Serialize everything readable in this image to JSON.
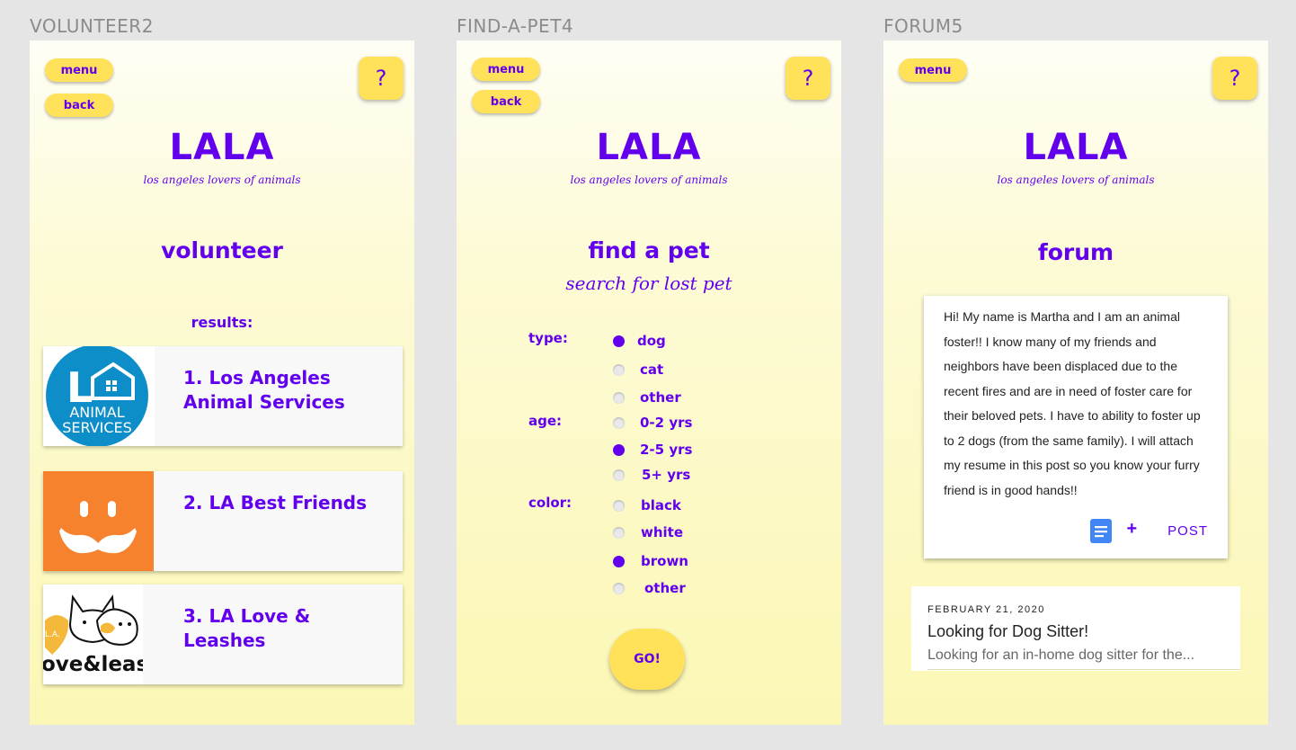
{
  "frames": [
    {
      "label": "VOLUNTEER2"
    },
    {
      "label": "FIND-A-PET4"
    },
    {
      "label": "FORUM5"
    }
  ],
  "common": {
    "menu": "menu",
    "back": "back",
    "help": "?",
    "logo": "LALA",
    "tagline": "los angeles lovers of animals"
  },
  "volunteer": {
    "heading": "volunteer",
    "results_label": "results:",
    "results": [
      {
        "title": "1. Los Angeles Animal Services",
        "logo_text_1": "ANIMAL",
        "logo_text_2": "SERVICES",
        "logo_letter": "L"
      },
      {
        "title": "2. LA Best Friends"
      },
      {
        "title": "3. LA Love & Leashes",
        "logo_text": "ove&leas",
        "logo_badge": "L.A."
      }
    ]
  },
  "find_pet": {
    "heading": "find a pet",
    "subheading": "search for lost pet",
    "type_label": "type:",
    "age_label": "age:",
    "color_label": "color:",
    "type_options": [
      {
        "label": "dog",
        "checked": true
      },
      {
        "label": "cat",
        "checked": false
      },
      {
        "label": "other",
        "checked": false
      }
    ],
    "age_options": [
      {
        "label": "0-2 yrs",
        "checked": false
      },
      {
        "label": "2-5 yrs",
        "checked": true
      },
      {
        "label": "5+ yrs",
        "checked": false
      }
    ],
    "color_options": [
      {
        "label": "black",
        "checked": false
      },
      {
        "label": "white",
        "checked": false
      },
      {
        "label": "brown",
        "checked": true
      },
      {
        "label": "other",
        "checked": false
      }
    ],
    "go": "GO!"
  },
  "forum": {
    "heading": "forum",
    "post_text": "Hi! My name is Martha and I am an animal foster!! I know many of my friends and neighbors have been displaced due to the recent fires and are in need of foster care for their beloved pets. I have to ability to foster up to 2 dogs (from the same family). I will attach my resume in this post so you know your furry friend is in good hands!!",
    "attach_icon": "document-icon",
    "plus": "+",
    "post_button": "POST",
    "listing": {
      "date": "FEBRUARY 21, 2020",
      "title": "Looking for Dog Sitter!",
      "snippet": "Looking for an in-home dog sitter for the..."
    }
  },
  "colors": {
    "accent": "#6200ee",
    "button": "#ffe15a",
    "la_blue": "#0e8ec9",
    "best_friends_orange": "#f7822e",
    "heart_yellow": "#f4b83a",
    "doc_blue": "#4285f4"
  }
}
